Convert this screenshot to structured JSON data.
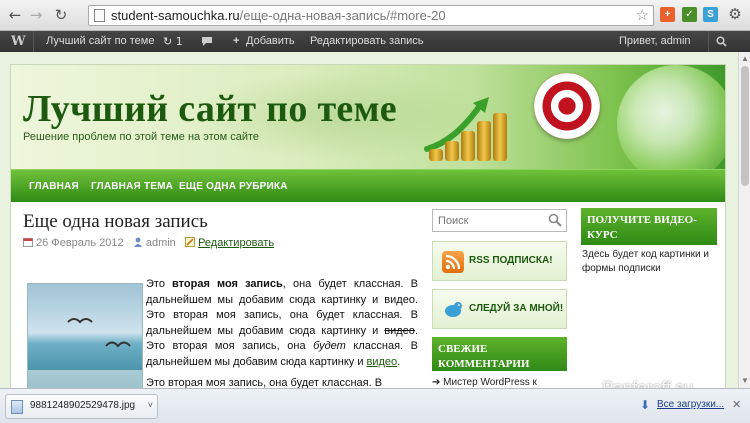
{
  "browser": {
    "back_icon": "←",
    "forward_icon": "→",
    "reload_icon": "↻",
    "url_domain": "student-samouchka.ru",
    "url_rest": "/еще-одна-новая-запись/#more-20",
    "star_icon": "☆"
  },
  "adminbar": {
    "wp_logo": "W",
    "site_name": "Лучший сайт по теме",
    "updates_count": "1",
    "comments_icon": "💬",
    "add_new": "Добавить",
    "add_icon": "+",
    "edit_post": "Редактировать запись",
    "howdy": "Привет, admin",
    "search_icon": "⌕"
  },
  "site": {
    "title": "Лучший сайт по теме",
    "description": "Решение проблем по этой теме на этом сайте",
    "nav": [
      "ГЛАВНАЯ",
      "ГЛАВНАЯ ТЕМА",
      "ЕЩЕ ОДНА РУБРИКА"
    ]
  },
  "post": {
    "title": "Еще одна новая запись",
    "date": "26 Февраль 2012",
    "author": "admin",
    "edit": "Редактировать",
    "p1_a": "Это ",
    "p1_bold": "вторая моя запись",
    "p1_b": ", она будет классная. В дальнейшем мы добавим сюда картинку и видео. Это вторая моя запись, она будет классная. В дальнейшем мы добавим сюда картинку и ",
    "p1_strike": "видео",
    "p1_c": ". Это вторая моя запись, она ",
    "p1_italic": "будет",
    "p1_d": " классная. В дальнейшем мы добавим сюда картинку и ",
    "p1_link": "видео",
    "p1_end": ".",
    "p2": "Это вторая моя запись, она будет классная. В"
  },
  "sidebar": {
    "search_placeholder": "Поиск",
    "rss_label": "RSS ПОДПИСКА!",
    "follow_label": "СЛЕДУЙ ЗА МНОЙ!",
    "recent_comments_heading": "СВЕЖИЕ КОММЕНТАРИИ",
    "recent_comment_item": "Мистер WordPress к",
    "video_heading": "ПОЛУЧИТЕ ВИДЕО-КУРС",
    "video_text": "Здесь будет код картинки и формы подписки"
  },
  "watermark": "Panferoff.su",
  "downloads": {
    "filename": "9881248902529478.jpg",
    "caret": "˅",
    "all_downloads": "Все загрузки...",
    "close_icon": "✕"
  },
  "colors": {
    "accent_green": "#2f8a15",
    "title_green": "#1d5a0f"
  }
}
